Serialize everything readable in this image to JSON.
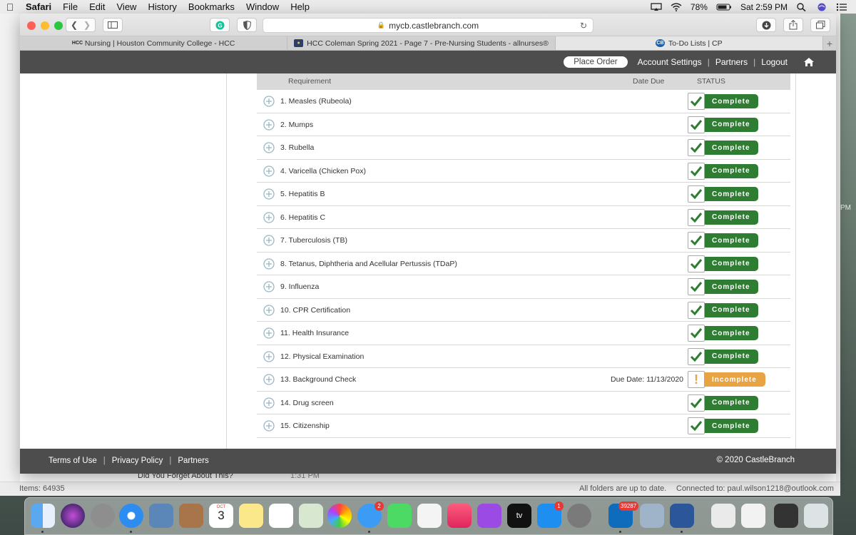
{
  "menubar": {
    "app": "Safari",
    "items": [
      "File",
      "Edit",
      "View",
      "History",
      "Bookmarks",
      "Window",
      "Help"
    ],
    "battery": "78%",
    "clock": "Sat 2:59 PM"
  },
  "browser": {
    "url": "mycb.castlebranch.com",
    "tabs": [
      {
        "label": "Nursing | Houston Community College - HCC",
        "favicon": "HCC"
      },
      {
        "label": "HCC Coleman Spring 2021 - Page 7 - Pre-Nursing Students - allnurses®",
        "favicon": "nurse"
      },
      {
        "label": "To-Do Lists | CP",
        "favicon": "CB"
      }
    ]
  },
  "site_header": {
    "place_order": "Place Order",
    "account_settings": "Account Settings",
    "partners": "Partners",
    "logout": "Logout"
  },
  "table": {
    "col_requirement": "Requirement",
    "col_date_due": "Date Due",
    "col_status": "STATUS",
    "rows": [
      {
        "name": "1. Measles (Rubeola)",
        "due": "",
        "status": "Complete"
      },
      {
        "name": "2. Mumps",
        "due": "",
        "status": "Complete"
      },
      {
        "name": "3. Rubella",
        "due": "",
        "status": "Complete"
      },
      {
        "name": "4. Varicella (Chicken Pox)",
        "due": "",
        "status": "Complete"
      },
      {
        "name": "5. Hepatitis B",
        "due": "",
        "status": "Complete"
      },
      {
        "name": "6. Hepatitis C",
        "due": "",
        "status": "Complete"
      },
      {
        "name": "7. Tuberculosis (TB)",
        "due": "",
        "status": "Complete"
      },
      {
        "name": "8. Tetanus, Diphtheria and Acellular Pertussis (TDaP)",
        "due": "",
        "status": "Complete"
      },
      {
        "name": "9. Influenza",
        "due": "",
        "status": "Complete"
      },
      {
        "name": "10. CPR Certification",
        "due": "",
        "status": "Complete"
      },
      {
        "name": "11. Health Insurance",
        "due": "",
        "status": "Complete"
      },
      {
        "name": "12. Physical Examination",
        "due": "",
        "status": "Complete"
      },
      {
        "name": "13. Background Check",
        "due": "Due Date: 11/13/2020",
        "status": "Incomplete"
      },
      {
        "name": "14. Drug screen",
        "due": "",
        "status": "Complete"
      },
      {
        "name": "15. Citizenship",
        "due": "",
        "status": "Complete"
      }
    ]
  },
  "site_footer": {
    "terms": "Terms of Use",
    "privacy": "Privacy Policy",
    "partners": "Partners",
    "copyright": "© 2020 CastleBranch"
  },
  "background_window": {
    "items_count": "Items: 64935",
    "sync_status": "All folders are up to date.",
    "connected": "Connected to: paul.wilson1218@outlook.com",
    "mail_subject": "Did You Forget About This?",
    "mail_time": "1:31 PM",
    "side_time": "PM"
  },
  "dock": {
    "calendar_month": "OCT",
    "calendar_day": "3",
    "messages_badge": "2",
    "appstore_badge": "1",
    "outlook_badge": "39287",
    "tv_label": "tv"
  },
  "colors": {
    "complete": "#2e7d32",
    "incomplete": "#e8a342",
    "header_bg": "#4d4d4d"
  }
}
